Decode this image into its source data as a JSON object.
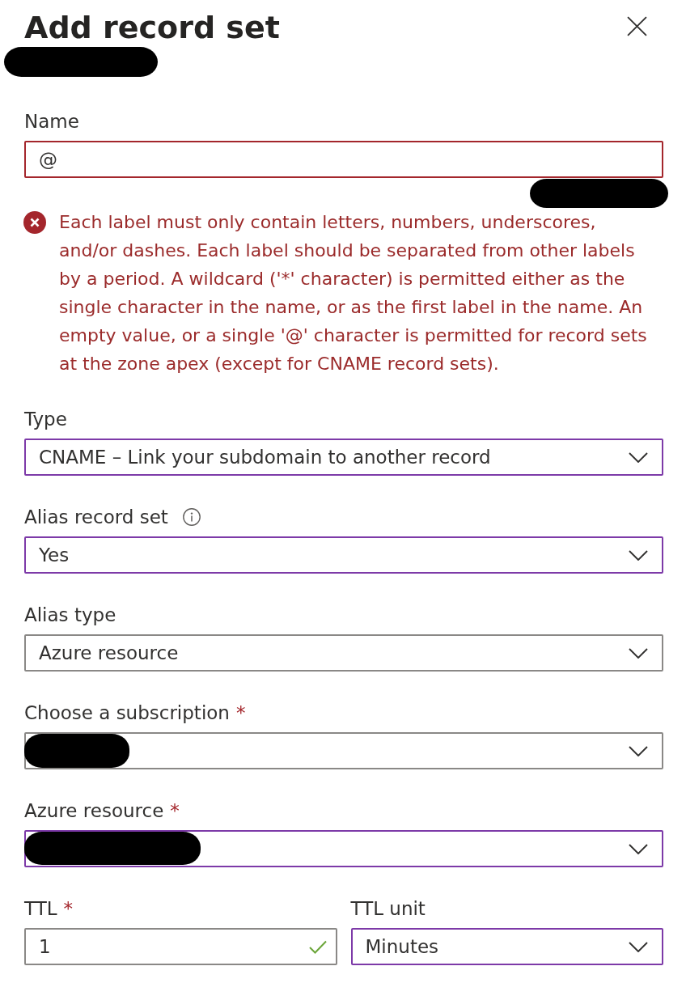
{
  "panel": {
    "title": "Add record set",
    "subtitle_redacted": true,
    "closable": true
  },
  "rows": [
    {
      "fields": [
        {
          "kind": "text",
          "label": "Name",
          "value": "@",
          "invalid": true,
          "note_redacted": true,
          "error": "Each label must only contain letters, numbers, underscores, and/or dashes. Each label should be separated from other labels by a period. A wildcard ('*' character) is permitted either as the single character in the name, or as the first label in the name. An empty value, or a single '@' character is permitted for record sets at the zone apex (except for CNAME record sets)."
        }
      ]
    },
    {
      "fields": [
        {
          "kind": "select",
          "label": "Type",
          "value": "CNAME – Link your subdomain to another record",
          "invalid": false,
          "modified": true
        }
      ]
    },
    {
      "fields": [
        {
          "kind": "select",
          "label": "Alias record set",
          "info": true,
          "value": "Yes",
          "invalid": false,
          "modified": true
        }
      ]
    },
    {
      "fields": [
        {
          "kind": "select",
          "label": "Alias type",
          "value": "Azure resource",
          "invalid": false,
          "modified": false
        }
      ]
    },
    {
      "fields": [
        {
          "kind": "select",
          "label": "Choose a subscription",
          "required_mark": "*",
          "value_redacted": true,
          "invalid": false,
          "modified": false
        }
      ]
    },
    {
      "fields": [
        {
          "kind": "select",
          "label": "Azure resource",
          "required_mark": "*",
          "value_redacted": true,
          "invalid": false,
          "modified": true
        }
      ]
    },
    {
      "fields": [
        {
          "kind": "text",
          "label": "TTL",
          "required_mark": "*",
          "value": "1",
          "invalid": false,
          "modified": false,
          "validated": true
        },
        {
          "kind": "select",
          "label": "TTL unit",
          "value": "Minutes",
          "invalid": false,
          "modified": true
        }
      ]
    }
  ]
}
